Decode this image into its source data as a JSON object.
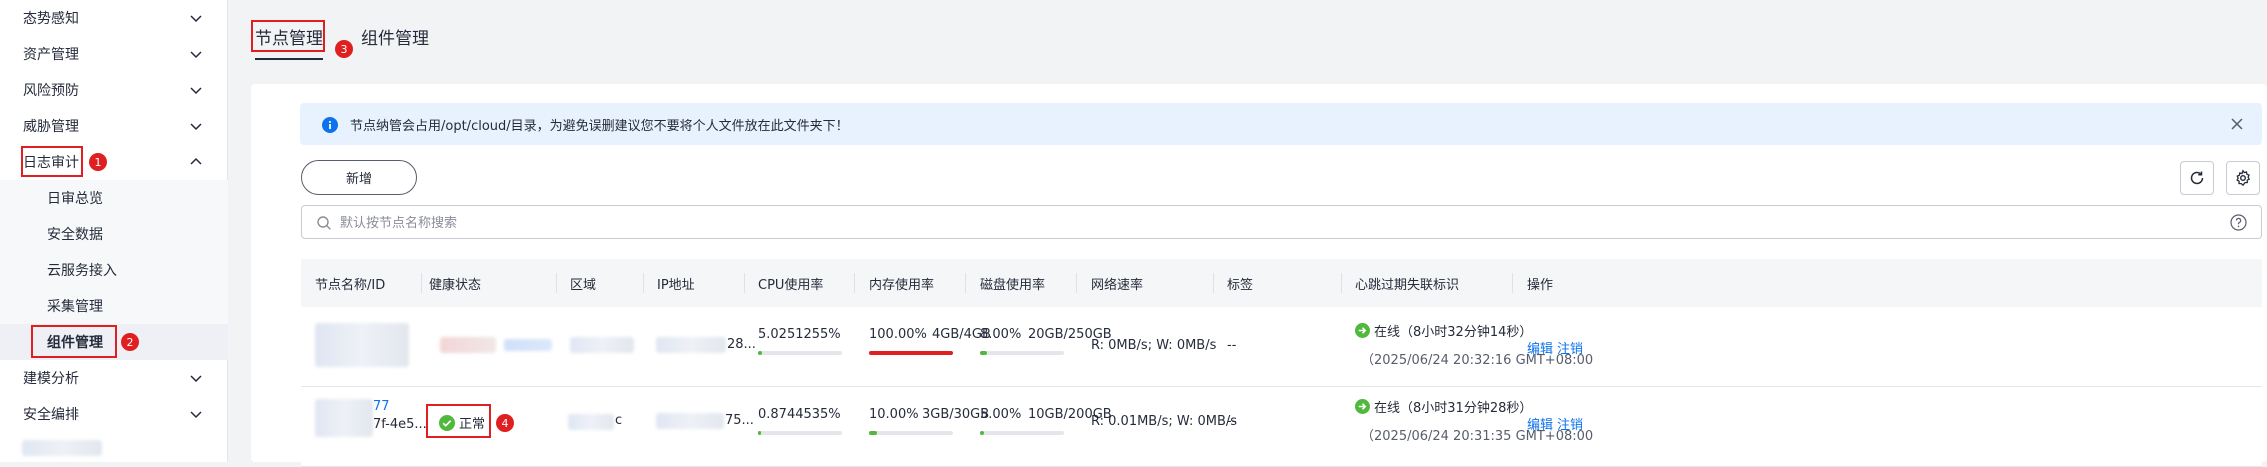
{
  "sidebar": {
    "items": [
      {
        "label": "态势感知",
        "expanded": false
      },
      {
        "label": "资产管理",
        "expanded": false
      },
      {
        "label": "风险预防",
        "expanded": false
      },
      {
        "label": "威胁管理",
        "expanded": false
      },
      {
        "label": "日志审计",
        "expanded": true
      },
      {
        "label": "建模分析",
        "expanded": false
      },
      {
        "label": "安全编排",
        "expanded": false
      }
    ],
    "sub_items": [
      {
        "label": "日审总览"
      },
      {
        "label": "安全数据"
      },
      {
        "label": "云服务接入"
      },
      {
        "label": "采集管理"
      },
      {
        "label": "组件管理",
        "active": true
      }
    ],
    "markers": {
      "log_audit": "1",
      "component_mgmt": "2"
    }
  },
  "tabs": {
    "items": [
      {
        "label": "节点管理",
        "active": true
      },
      {
        "label": "组件管理"
      }
    ],
    "marker": "3"
  },
  "alert": {
    "message": "节点纳管会占用/opt/cloud/目录，为避免误删建议您不要将个人文件放在此文件夹下！"
  },
  "toolbar": {
    "new_label": "新增"
  },
  "search": {
    "placeholder": "默认按节点名称搜索",
    "value": ""
  },
  "table": {
    "columns": [
      "节点名称/ID",
      "健康状态",
      "区域",
      "IP地址",
      "CPU使用率",
      "内存使用率",
      "磁盘使用率",
      "网络速率",
      "标签",
      "心跳过期失联标识",
      "操作"
    ],
    "rows": [
      {
        "name": "",
        "id": "",
        "health": "",
        "region": "",
        "ip_suffix": "28...",
        "cpu": "5.0251255%",
        "cpu_fraction": 0.05,
        "mem": "100.00%",
        "mem_detail": "4GB/4GB",
        "mem_fraction": 1.0,
        "disk": "8.00%",
        "disk_detail": "20GB/250GB",
        "disk_fraction": 0.08,
        "network": "R: 0MB/s; W: 0MB/s",
        "tags": "--",
        "heartbeat": "在线（8小时32分钟14秒）",
        "heartbeat_time": "（2025/06/24 20:32:16 GMT+08:00",
        "action_edit": "编辑",
        "action_deregister": "注销"
      },
      {
        "name": "77",
        "id": "7f-4e5...",
        "health": "正常",
        "health_marker": "4",
        "region_suffix": "c",
        "ip_suffix": "75...",
        "cpu": "0.8744535%",
        "cpu_fraction": 0.009,
        "mem": "10.00%",
        "mem_detail": "3GB/30GB",
        "mem_fraction": 0.1,
        "disk": "5.00%",
        "disk_detail": "10GB/200GB",
        "disk_fraction": 0.05,
        "network": "R: 0.01MB/s; W: 0MB/s",
        "tags": "--",
        "heartbeat": "在线（8小时31分钟28秒）",
        "heartbeat_time": "（2025/06/24 20:31:35 GMT+08:00",
        "action_edit": "编辑",
        "action_deregister": "注销"
      }
    ]
  },
  "colors": {
    "accent": "#0e72ed",
    "success": "#50b83c",
    "danger": "#e02020",
    "bar_default": "#50b83c",
    "bar_full": "#e02020"
  }
}
